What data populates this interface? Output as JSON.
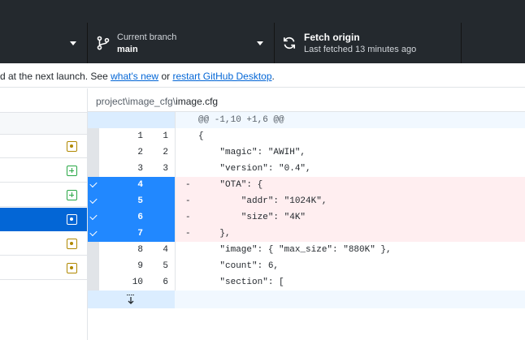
{
  "toolbar": {
    "branch": {
      "title": "Current branch",
      "value": "main"
    },
    "fetch": {
      "title": "Fetch origin",
      "subtitle": "Last fetched 13 minutes ago"
    }
  },
  "banner": {
    "text_before": "d at the next launch. See ",
    "link_whats_new": "what's new",
    "text_middle": " or ",
    "link_restart": "restart GitHub Desktop",
    "text_after": "."
  },
  "sidebar": {
    "files": [
      {
        "status": "modified",
        "selected": false
      },
      {
        "status": "added",
        "selected": false
      },
      {
        "status": "added",
        "selected": false
      },
      {
        "status": "modified",
        "selected": true
      },
      {
        "status": "modified",
        "selected": false
      },
      {
        "status": "modified",
        "selected": false
      }
    ]
  },
  "diff": {
    "path_prefix": "project\\image_cfg\\",
    "file_name": "image.cfg",
    "hunk_header": "@@ -1,10 +1,6 @@",
    "lines": [
      {
        "type": "context",
        "old": "1",
        "new": "1",
        "sign": "",
        "code": "{"
      },
      {
        "type": "context",
        "old": "2",
        "new": "2",
        "sign": "",
        "code": "    \"magic\": \"AWIH\","
      },
      {
        "type": "context",
        "old": "3",
        "new": "3",
        "sign": "",
        "code": "    \"version\": \"0.4\","
      },
      {
        "type": "deleted",
        "old": "4",
        "new": "",
        "sign": "-",
        "code": "    \"OTA\": {"
      },
      {
        "type": "deleted",
        "old": "5",
        "new": "",
        "sign": "-",
        "code": "        \"addr\": \"1024K\","
      },
      {
        "type": "deleted",
        "old": "6",
        "new": "",
        "sign": "-",
        "code": "        \"size\": \"4K\""
      },
      {
        "type": "deleted",
        "old": "7",
        "new": "",
        "sign": "-",
        "code": "    },"
      },
      {
        "type": "context",
        "old": "8",
        "new": "4",
        "sign": "",
        "code": "    \"image\": { \"max_size\": \"880K\" },"
      },
      {
        "type": "context",
        "old": "9",
        "new": "5",
        "sign": "",
        "code": "    \"count\": 6,"
      },
      {
        "type": "context",
        "old": "10",
        "new": "6",
        "sign": "",
        "code": "    \"section\": ["
      }
    ]
  },
  "colors": {
    "toolbar_bg": "#24292e",
    "accent": "#0366d6",
    "deleted_bg": "#ffeef0",
    "selected_gutter": "#2188ff"
  }
}
